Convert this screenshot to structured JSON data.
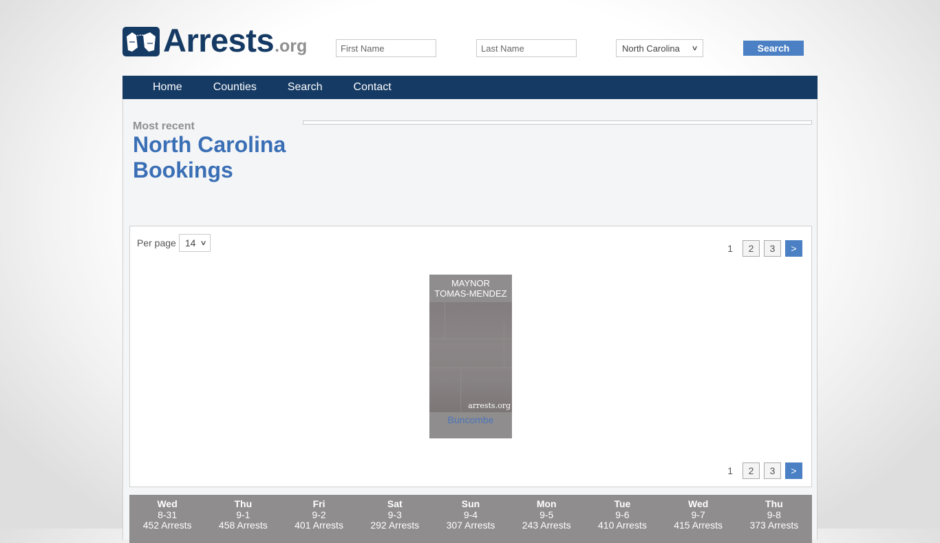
{
  "header": {
    "logo_text": "Arrests",
    "logo_tld": ".org",
    "first_name_placeholder": "First Name",
    "last_name_placeholder": "Last Name",
    "state_selected": "North Carolina",
    "search_label": "Search"
  },
  "nav": {
    "items": [
      {
        "label": "Home"
      },
      {
        "label": "Counties"
      },
      {
        "label": "Search"
      },
      {
        "label": "Contact"
      }
    ]
  },
  "main": {
    "subtitle": "Most recent",
    "title": "North Carolina Bookings",
    "per_page_label": "Per page",
    "per_page_value": "14",
    "pagination": {
      "current": "1",
      "pages": [
        "2",
        "3"
      ],
      "next_label": ">"
    },
    "bookings": [
      {
        "first_name": "MAYNOR",
        "last_name": "TOMAS-MENDEZ",
        "watermark": "arrests.org",
        "county": "Buncombe"
      }
    ]
  },
  "days": [
    {
      "day": "Wed",
      "date": "8-31",
      "count": "452 Arrests"
    },
    {
      "day": "Thu",
      "date": "9-1",
      "count": "458 Arrests"
    },
    {
      "day": "Fri",
      "date": "9-2",
      "count": "401 Arrests"
    },
    {
      "day": "Sat",
      "date": "9-3",
      "count": "292 Arrests"
    },
    {
      "day": "Sun",
      "date": "9-4",
      "count": "307 Arrests"
    },
    {
      "day": "Mon",
      "date": "9-5",
      "count": "243 Arrests"
    },
    {
      "day": "Tue",
      "date": "9-6",
      "count": "410 Arrests"
    },
    {
      "day": "Wed",
      "date": "9-7",
      "count": "415 Arrests"
    },
    {
      "day": "Thu",
      "date": "9-8",
      "count": "373 Arrests"
    }
  ]
}
